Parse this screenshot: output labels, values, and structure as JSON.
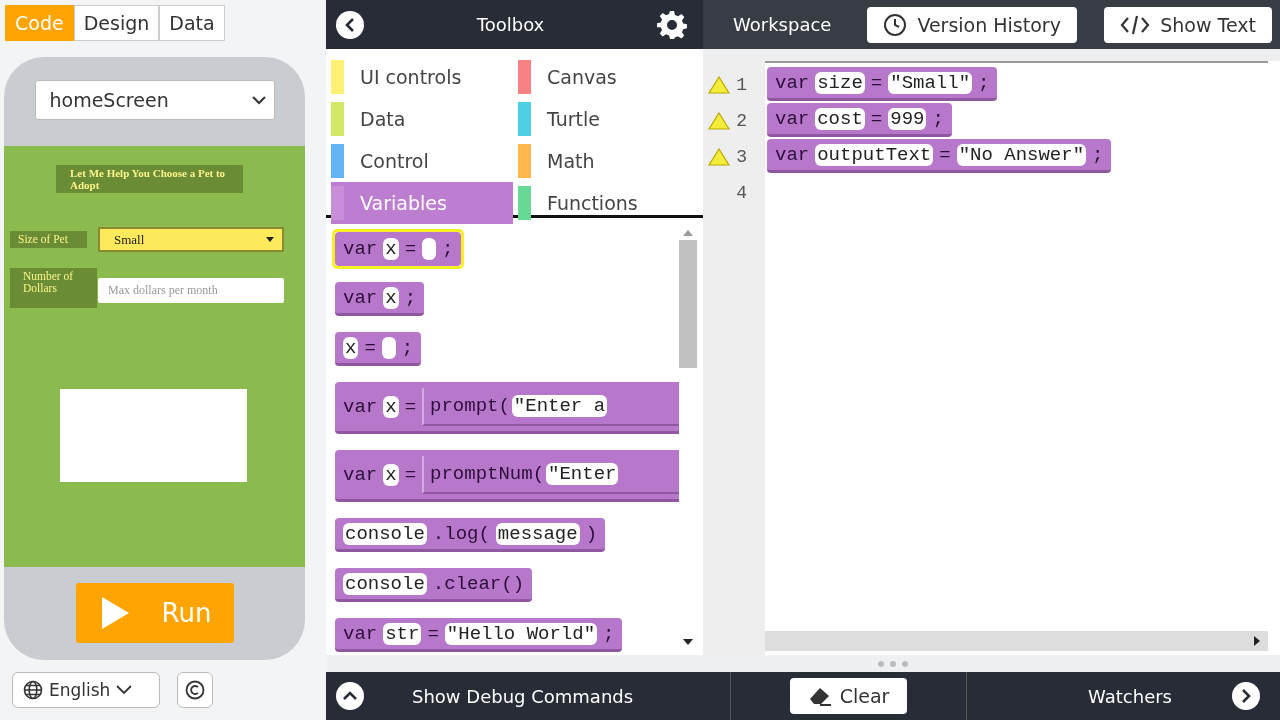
{
  "mode_tabs": [
    {
      "label": "Code",
      "selected": true
    },
    {
      "label": "Design",
      "selected": false
    },
    {
      "label": "Data",
      "selected": false
    }
  ],
  "screen_select": {
    "value": "homeScreen"
  },
  "app": {
    "title": "Let Me Help You Choose a Pet to Adopt",
    "size_label": "Size of Pet",
    "size_dropdown": {
      "value": "Small"
    },
    "dollars_label": "Number of Dollars",
    "dollars_field": {
      "placeholder": "Max dollars per month"
    }
  },
  "run_button": {
    "label": "Run"
  },
  "language_select": {
    "value": "English"
  },
  "toolbox": {
    "title": "Toolbox",
    "categories": [
      {
        "label": "UI controls",
        "color": "#fff176",
        "selected": false
      },
      {
        "label": "Canvas",
        "color": "#f78183",
        "selected": false
      },
      {
        "label": "Data",
        "color": "#d3e965",
        "selected": false
      },
      {
        "label": "Turtle",
        "color": "#4dd0e1",
        "selected": false
      },
      {
        "label": "Control",
        "color": "#64b5f6",
        "selected": false
      },
      {
        "label": "Math",
        "color": "#ffb74d",
        "selected": false
      },
      {
        "label": "Variables",
        "color": "#c88ed8",
        "selected": true
      },
      {
        "label": "Functions",
        "color": "#68d995",
        "selected": false
      }
    ],
    "blocks": [
      {
        "kind": "highlighted",
        "parts": [
          {
            "kind": "code",
            "text": "var"
          },
          {
            "kind": "slot",
            "text": "x"
          },
          {
            "kind": "code",
            "text": "="
          },
          {
            "kind": "empty"
          },
          {
            "kind": "code",
            "text": ";"
          }
        ]
      },
      {
        "kind": "plain",
        "parts": [
          {
            "kind": "code",
            "text": "var"
          },
          {
            "kind": "slot",
            "text": "x"
          },
          {
            "kind": "code",
            "text": ";"
          }
        ]
      },
      {
        "kind": "plain",
        "parts": [
          {
            "kind": "slot",
            "text": "x"
          },
          {
            "kind": "code",
            "text": "="
          },
          {
            "kind": "empty"
          },
          {
            "kind": "code",
            "text": ";"
          }
        ]
      },
      {
        "kind": "plain",
        "parts": [
          {
            "kind": "code",
            "text": "var"
          },
          {
            "kind": "slot",
            "text": "x"
          },
          {
            "kind": "code",
            "text": "="
          },
          {
            "kind": "nested",
            "parts": [
              {
                "kind": "code",
                "text": "prompt("
              },
              {
                "kind": "slot",
                "text": "\"Enter a"
              }
            ]
          }
        ]
      },
      {
        "kind": "plain",
        "parts": [
          {
            "kind": "code",
            "text": "var"
          },
          {
            "kind": "slot",
            "text": "x"
          },
          {
            "kind": "code",
            "text": "="
          },
          {
            "kind": "nested",
            "parts": [
              {
                "kind": "code",
                "text": "promptNum("
              },
              {
                "kind": "slot",
                "text": "\"Enter"
              }
            ]
          }
        ]
      },
      {
        "kind": "plain",
        "parts": [
          {
            "kind": "slot",
            "text": "console"
          },
          {
            "kind": "code",
            "text": ".log("
          },
          {
            "kind": "slot",
            "text": "message"
          },
          {
            "kind": "code",
            "text": ")"
          }
        ]
      },
      {
        "kind": "plain",
        "parts": [
          {
            "kind": "slot",
            "text": "console"
          },
          {
            "kind": "code",
            "text": ".clear()"
          }
        ]
      },
      {
        "kind": "plain",
        "parts": [
          {
            "kind": "code",
            "text": "var"
          },
          {
            "kind": "slot",
            "text": "str"
          },
          {
            "kind": "code",
            "text": "="
          },
          {
            "kind": "slot",
            "text": "\"Hello World\""
          },
          {
            "kind": "code",
            "text": ";"
          }
        ]
      }
    ]
  },
  "workspace": {
    "title": "Workspace",
    "buttons": [
      "Version History",
      "Show Text"
    ],
    "lines": [
      {
        "number": "1",
        "warning": true
      },
      {
        "number": "2",
        "warning": true
      },
      {
        "number": "3",
        "warning": true
      },
      {
        "number": "4",
        "warning": false
      }
    ],
    "blocks": [
      {
        "parts": [
          {
            "kind": "code",
            "text": "var"
          },
          {
            "kind": "slot",
            "text": "size"
          },
          {
            "kind": "code",
            "text": "="
          },
          {
            "kind": "slot",
            "text": "\"Small\""
          },
          {
            "kind": "code",
            "text": ";"
          }
        ]
      },
      {
        "parts": [
          {
            "kind": "code",
            "text": "var"
          },
          {
            "kind": "slot",
            "text": "cost"
          },
          {
            "kind": "code",
            "text": "="
          },
          {
            "kind": "slot",
            "text": "999"
          },
          {
            "kind": "code",
            "text": ";"
          }
        ]
      },
      {
        "parts": [
          {
            "kind": "code",
            "text": "var"
          },
          {
            "kind": "slot",
            "text": "outputText"
          },
          {
            "kind": "code",
            "text": "="
          },
          {
            "kind": "slot",
            "text": "\"No Answer\""
          },
          {
            "kind": "code",
            "text": ";"
          }
        ]
      }
    ]
  },
  "debug_bar": {
    "label": "Show Debug Commands",
    "clear_button": "Clear",
    "watchers": "Watchers"
  }
}
